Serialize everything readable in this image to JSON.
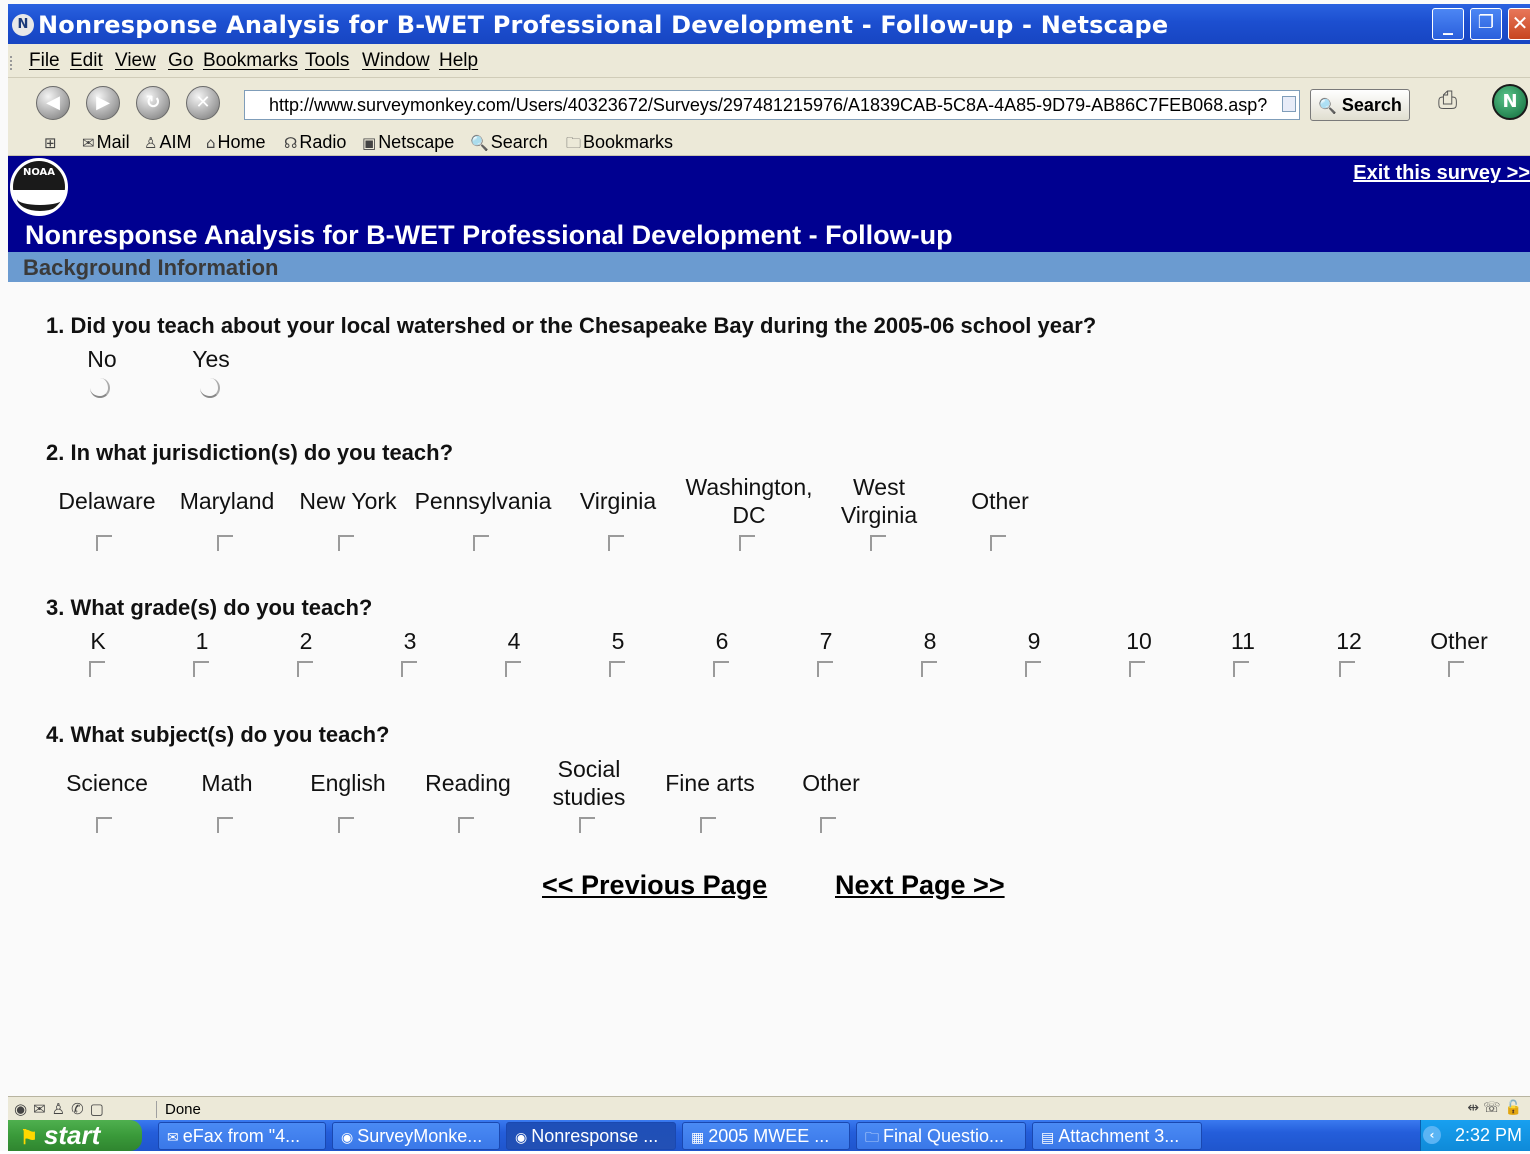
{
  "window": {
    "title": "Nonresponse Analysis for B-WET Professional Development - Follow-up - Netscape"
  },
  "menu": [
    "File",
    "Edit",
    "View",
    "Go",
    "Bookmarks",
    "Tools",
    "Window",
    "Help"
  ],
  "navigation": {
    "url": "http://www.surveymonkey.com/Users/40323672/Surveys/297481215976/A1839CAB-5C8A-4A85-9D79-AB86C7FEB068.asp?",
    "search_label": "Search"
  },
  "personal_toolbar": [
    "Mail",
    "AIM",
    "Home",
    "Radio",
    "Netscape",
    "Search",
    "Bookmarks"
  ],
  "survey": {
    "logo_text": "NOAA",
    "exit_link": "Exit this survey >>",
    "title": "Nonresponse Analysis for B-WET Professional Development - Follow-up",
    "section": "Background Information",
    "q1": {
      "text": "1. Did you teach about your local watershed or the Chesapeake Bay during the 2005-06 school year?",
      "options": [
        "No",
        "Yes"
      ]
    },
    "q2": {
      "text": "2. In what jurisdiction(s) do you teach?",
      "options": [
        "Delaware",
        "Maryland",
        "New York",
        "Pennsylvania",
        "Virginia",
        "Washington, DC",
        "West Virginia",
        "Other"
      ]
    },
    "q3": {
      "text": "3. What grade(s) do you teach?",
      "options": [
        "K",
        "1",
        "2",
        "3",
        "4",
        "5",
        "6",
        "7",
        "8",
        "9",
        "10",
        "11",
        "12",
        "Other"
      ]
    },
    "q4": {
      "text": "4. What subject(s) do you teach?",
      "options": [
        "Science",
        "Math",
        "English",
        "Reading",
        "Social studies",
        "Fine arts",
        "Other"
      ]
    },
    "prev_link": "<< Previous Page",
    "next_link": "Next Page >>"
  },
  "statusbar": {
    "text": "Done"
  },
  "taskbar": {
    "start_label": "start",
    "tasks": [
      "eFax from \"4...",
      "SurveyMonke...",
      "Nonresponse ...",
      "2005 MWEE ...",
      "Final Questio...",
      "Attachment 3..."
    ],
    "clock": "2:32 PM"
  }
}
